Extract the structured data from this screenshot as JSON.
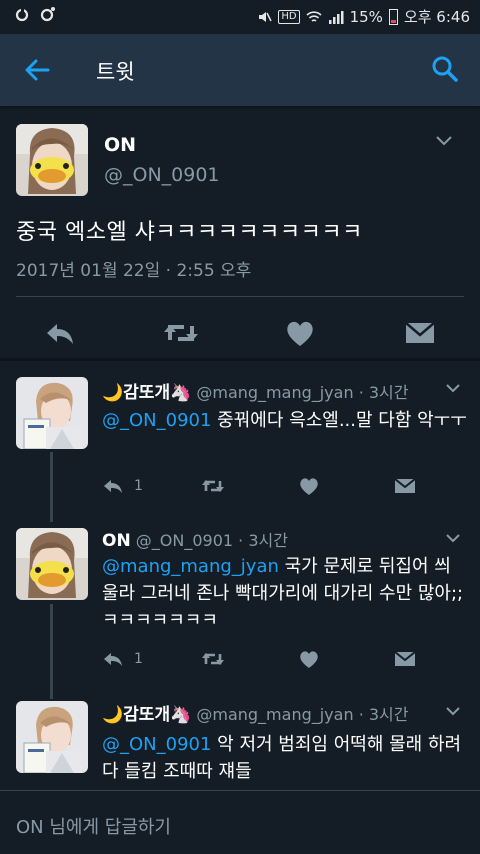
{
  "status_bar": {
    "battery_percent": "15%",
    "time": "오후 6:46",
    "hd_label": "HD"
  },
  "app_bar": {
    "title": "트윗"
  },
  "main_tweet": {
    "name": "ON",
    "handle": "@_ON_0901",
    "text": "중국 엑소엘 샤ㅋㅋㅋㅋㅋㅋㅋㅋㅋㅋ",
    "timestamp": "2017년 01월 22일 · 2:55 오후"
  },
  "replies": [
    {
      "name": "🌙감또개🦄",
      "handle": "@mang_mang_jyan",
      "time": "· 3시간",
      "mention": "@_ON_0901",
      "text": " 중꿔에다 윽소엘...말 다함 악ㅜㅜ",
      "reply_count": "1"
    },
    {
      "name": "ON",
      "handle": "@_ON_0901",
      "time": "· 3시간",
      "mention": "@mang_mang_jyan",
      "text": " 국가 문제로 뒤집어 씌울라 그러네 존나 빡대가리에 대가리 수만 많아;; ㅋㅋㅋㅋㅋㅋㅋ",
      "reply_count": "1"
    },
    {
      "name": "🌙감또개🦄",
      "handle": "@mang_mang_jyan",
      "time": "· 3시간",
      "mention": "@_ON_0901",
      "text": " 악 저거 범죄임 어떡해 몰래 하려다 들킴 조때따 쟤들",
      "reply_count": ""
    }
  ],
  "compose": {
    "placeholder": "ON 님에게 답글하기"
  },
  "colors": {
    "background": "#141d26",
    "app_bar": "#243447",
    "accent": "#1da1f2",
    "secondary_text": "#8899a6",
    "icon": "#8899a6"
  }
}
